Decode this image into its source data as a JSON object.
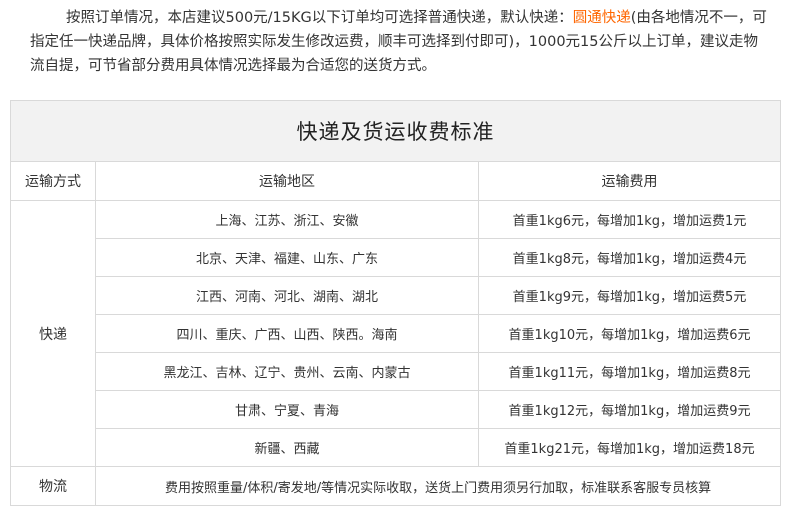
{
  "intro": {
    "part1": "按照订单情况，本店建议500元/15KG以下订单均可选择普通快递，默认快递：",
    "highlight": "圆通快递",
    "part2": "(由各地情况不一，可指定任一快递品牌，具体价格按照实际发生修改运费，顺丰可选择到付即可)，1000元15公斤以上订单，建议走物流自提，可节省部分费用具体情况选择最为合适您的送货方式。",
    "highlight_color": "#ff6600"
  },
  "table": {
    "title": "快递及货运收费标准",
    "headers": [
      "运输方式",
      "运输地区",
      "运输费用"
    ],
    "express_label": "快递",
    "rows": [
      {
        "region": "上海、江苏、浙江、安徽",
        "fee": "首重1kg6元，每增加1kg，增加运费1元"
      },
      {
        "region": "北京、天津、福建、山东、广东",
        "fee": "首重1kg8元，每增加1kg，增加运费4元"
      },
      {
        "region": "江西、河南、河北、湖南、湖北",
        "fee": "首重1kg9元，每增加1kg，增加运费5元"
      },
      {
        "region": "四川、重庆、广西、山西、陕西。海南",
        "fee": "首重1kg10元，每增加1kg，增加运费6元"
      },
      {
        "region": "黑龙江、吉林、辽宁、贵州、云南、内蒙古",
        "fee": "首重1kg11元，每增加1kg，增加运费8元"
      },
      {
        "region": "甘肃、宁夏、青海",
        "fee": "首重1kg12元，每增加1kg，增加运费9元"
      },
      {
        "region": "新疆、西藏",
        "fee": "首重1kg21元，每增加1kg，增加运费18元"
      }
    ],
    "logistics_label": "物流",
    "logistics_text": "费用按照重量/体积/寄发地/等情况实际收取，送货上门费用须另行加取，标准联系客服专员核算",
    "header_bg": "#f2f2f2",
    "border_color": "#d9d9d9"
  }
}
